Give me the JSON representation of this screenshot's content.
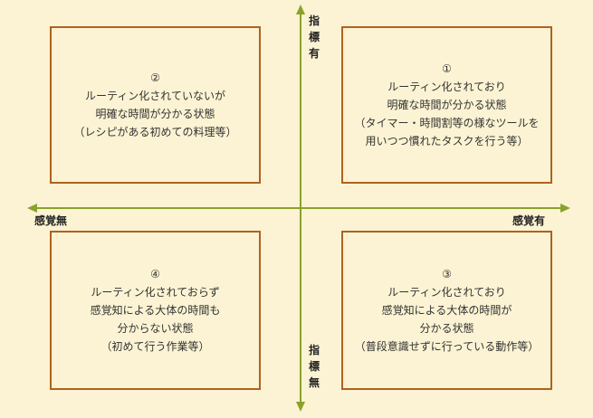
{
  "axes": {
    "top": "指標有",
    "bottom": "指標無",
    "left": "感覚無",
    "right": "感覚有",
    "color": "#8aa22d"
  },
  "quadrants": {
    "q1": [
      "①",
      "ルーティン化されており",
      "明確な時間が分かる状態",
      "（タイマー・時間割等の様なツールを",
      "用いつつ慣れたタスクを行う等）"
    ],
    "q2": [
      "②",
      "ルーティン化されていないが",
      "明確な時間が分かる状態",
      "（レシピがある初めての料理等）"
    ],
    "q3": [
      "③",
      "ルーティン化されており",
      "感覚知による大体の時間が",
      "分かる状態",
      "（普段意識せずに行っている動作等）"
    ],
    "q4": [
      "④",
      "ルーティン化されておらず",
      "感覚知による大体の時間も",
      "分からない状態",
      "（初めて行う作業等）"
    ]
  },
  "colors": {
    "background": "#fbf3d3",
    "box_border": "#b0611f",
    "text": "#333333"
  }
}
